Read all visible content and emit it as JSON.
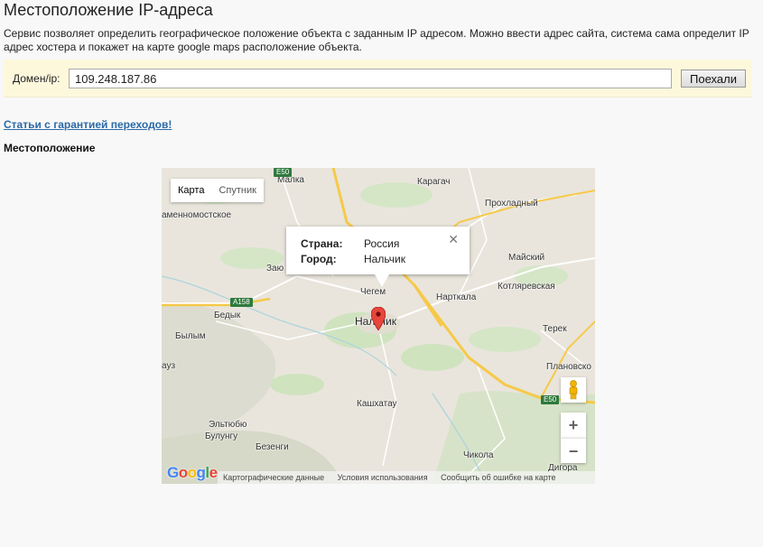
{
  "page": {
    "title": "Местоположение IP-адреса",
    "description": "Сервис позволяет определить географическое положение объекта с заданным IP адресом. Можно ввести адрес сайта, система сама определит IP адрес хостера и покажет на карте google maps расположение объекта."
  },
  "form": {
    "label": "Домен/ip:",
    "input_value": "109.248.187.86",
    "button_label": "Поехали"
  },
  "links": {
    "articles": "Статьи с гарантией переходов!"
  },
  "section": {
    "heading": "Местоположение"
  },
  "map": {
    "type_tabs": [
      "Карта",
      "Спутник"
    ],
    "active_tab": "Карта",
    "info": {
      "country_label": "Страна:",
      "country_value": "Россия",
      "city_label": "Город:",
      "city_value": "Нальчик",
      "close_symbol": "✕"
    },
    "places": {
      "malka": "Малка",
      "karagach": "Карагач",
      "proxladny": "Прохладный",
      "kamennomostskoe": "аменномостское",
      "mayskiy": "Майский",
      "kotlyarevskaya": "Котляревская",
      "zayu": "Заю",
      "chegem": "Чегем",
      "nartkala": "Нарткала",
      "bedyk": "Бедык",
      "nalchik": "Нальчик",
      "terek": "Терек",
      "bylym": "Былым",
      "auz": "ауз",
      "planovskoe": "Плановско",
      "kashkhatau": "Кашхатау",
      "eltyubyu": "Эльтюбю",
      "bulungu": "Булунгу",
      "bezengi": "Безенги",
      "chikola": "Чикола",
      "digora": "Дигора"
    },
    "road_badges": {
      "e50_top": "E50",
      "a158": "A158",
      "e50_right": "E50"
    },
    "zoom_in": "+",
    "zoom_out": "−",
    "pegman_icon": "pegman-icon",
    "logo_letters": [
      "G",
      "o",
      "o",
      "g",
      "l",
      "e"
    ],
    "footer": {
      "map_data": "Картографические данные",
      "terms": "Условия использования",
      "report": "Сообщить об ошибке на карте"
    },
    "colors": {
      "marker": "#e8453c",
      "road_major": "#f6c94a",
      "green": "#cfe3bf",
      "water": "#aad3df"
    }
  }
}
